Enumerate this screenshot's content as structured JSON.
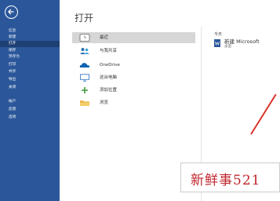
{
  "sidebar": {
    "back_icon": "back-arrow-icon",
    "items": [
      {
        "label": "信息"
      },
      {
        "label": "新建"
      },
      {
        "label": "打开",
        "active": true
      },
      {
        "label": "保存"
      },
      {
        "label": "另存为"
      },
      {
        "label": "打印"
      },
      {
        "label": "共享"
      },
      {
        "label": "导出"
      },
      {
        "label": "关闭"
      },
      {
        "label": "帐户"
      },
      {
        "label": "反馈"
      },
      {
        "label": "选项"
      }
    ]
  },
  "main": {
    "title": "打开",
    "locations": [
      {
        "label": "最近",
        "icon": "clock-icon",
        "selected": true
      },
      {
        "label": "与我共享",
        "icon": "people-icon"
      },
      {
        "label": "OneDrive",
        "icon": "cloud-icon"
      },
      {
        "label": "这台电脑",
        "icon": "computer-icon"
      },
      {
        "label": "添加位置",
        "icon": "plus-icon"
      },
      {
        "label": "浏览",
        "icon": "folder-icon"
      }
    ],
    "recent": {
      "group_label": "今天",
      "file_name": "新建 Microsoft",
      "file_path": "桌面"
    }
  },
  "watermark": {
    "text": "新鲜事521"
  },
  "colors": {
    "sidebar": "#2b579a",
    "active_item": "#1e3f73",
    "selected_location": "#d6d6d6",
    "watermark_text": "#c0262d"
  }
}
